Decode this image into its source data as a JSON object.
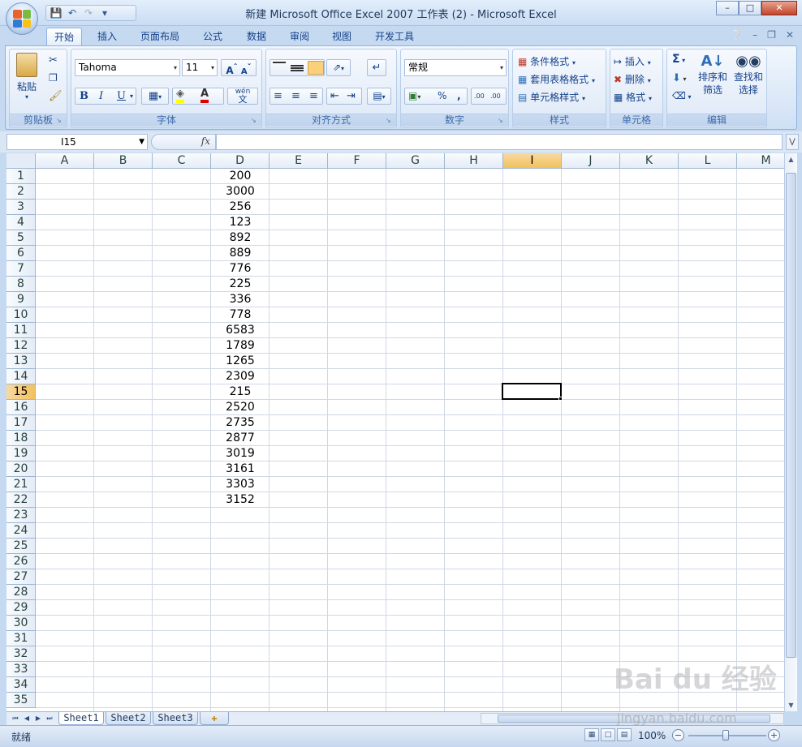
{
  "window": {
    "title": "新建 Microsoft Office Excel 2007 工作表 (2) - Microsoft Excel",
    "buttons": [
      "–",
      "□",
      "✕"
    ]
  },
  "quick_access": [
    "save-icon",
    "undo-icon",
    "redo-icon",
    "customize-icon"
  ],
  "ribbon_tabs": [
    "开始",
    "插入",
    "页面布局",
    "公式",
    "数据",
    "审阅",
    "视图",
    "开发工具"
  ],
  "ribbon_active_tab": "开始",
  "ribbon": {
    "clipboard": {
      "paste": "粘贴",
      "label": "剪贴板"
    },
    "font": {
      "name": "Tahoma",
      "size": "11",
      "bold": "B",
      "italic": "I",
      "underline": "U",
      "grow": "A",
      "shrink": "A",
      "label": "字体",
      "wen": "wén",
      "wen_char": "文"
    },
    "alignment": {
      "label": "对齐方式"
    },
    "number": {
      "format": "常规",
      "percent": "%",
      "comma": ",",
      "inc_decimal": ".00",
      "label": "数字"
    },
    "styles": {
      "cond_format": "条件格式",
      "table_format": "套用表格格式",
      "cell_styles": "单元格样式",
      "label": "样式"
    },
    "cells": {
      "insert": "插入",
      "delete": "删除",
      "format": "格式",
      "label": "单元格"
    },
    "editing": {
      "sum": "Σ",
      "sort_filter": "排序和筛选",
      "find_select": "查找和选择",
      "label": "编辑"
    }
  },
  "formula_bar": {
    "name_box": "I15",
    "fx": "fx",
    "formula": ""
  },
  "columns": [
    "A",
    "B",
    "C",
    "D",
    "E",
    "F",
    "G",
    "H",
    "I",
    "J",
    "K",
    "L",
    "M"
  ],
  "rows": [
    "1",
    "2",
    "3",
    "4",
    "5",
    "6",
    "7",
    "8",
    "9",
    "10",
    "11",
    "12",
    "13",
    "14",
    "15",
    "16",
    "17",
    "18",
    "19",
    "20",
    "21",
    "22",
    "23",
    "24",
    "25",
    "26",
    "27",
    "28",
    "29",
    "30",
    "31",
    "32",
    "33",
    "34",
    "35"
  ],
  "selected_cell": {
    "column": "I",
    "row": "15"
  },
  "column_d_values": [
    "200",
    "3000",
    "256",
    "123",
    "892",
    "889",
    "776",
    "225",
    "336",
    "778",
    "6583",
    "1789",
    "1265",
    "2309",
    "215",
    "2520",
    "2735",
    "2877",
    "3019",
    "3161",
    "3303",
    "3152"
  ],
  "sheet_tabs": [
    "Sheet1",
    "Sheet2",
    "Sheet3"
  ],
  "active_sheet": "Sheet1",
  "status": {
    "ready": "就绪",
    "zoom": "100%"
  },
  "watermark": {
    "logo": "Bai du 经验",
    "url": "jingyan.baidu.com"
  }
}
